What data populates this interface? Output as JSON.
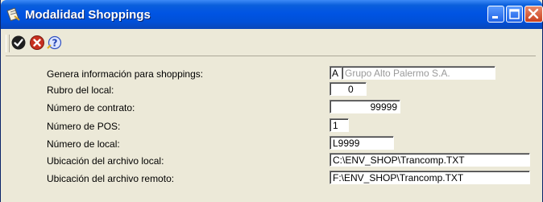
{
  "window": {
    "title": "Modalidad Shoppings"
  },
  "toolbar": {
    "buttons": [
      {
        "icon": "check-icon",
        "color": "#1a1a1a"
      },
      {
        "icon": "cancel-icon",
        "color": "#c83020"
      },
      {
        "icon": "help-icon",
        "color": "#3050c0"
      }
    ]
  },
  "form": {
    "genera": {
      "label": "Genera información para shoppings:",
      "code": "A",
      "value": "Grupo Alto Palermo S.A."
    },
    "rubro": {
      "label": "Rubro del local:",
      "value": "0"
    },
    "contrato": {
      "label": "Número de contrato:",
      "value": "99999"
    },
    "pos": {
      "label": "Número de POS:",
      "value": "1"
    },
    "local": {
      "label": "Número de local:",
      "value": "L9999"
    },
    "archivo_local": {
      "label": "Ubicación del archivo local:",
      "value": "C:\\ENV_SHOP\\Trancomp.TXT"
    },
    "archivo_remoto": {
      "label": "Ubicación del archivo remoto:",
      "value": "F:\\ENV_SHOP\\Trancomp.TXT"
    }
  }
}
